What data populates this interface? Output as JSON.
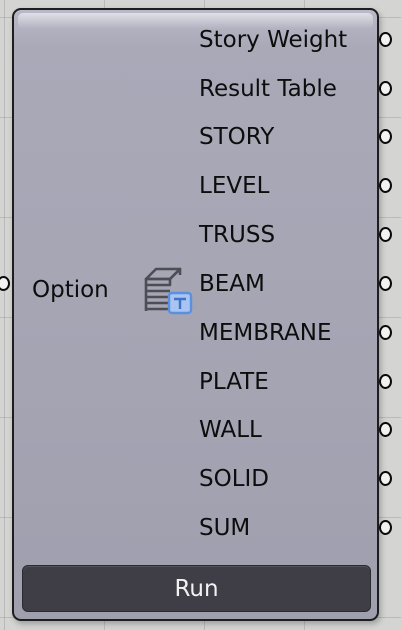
{
  "component": {
    "input_label": "Option",
    "outputs": [
      "Story Weight",
      "Result Table",
      "STORY",
      "LEVEL",
      "TRUSS",
      "BEAM",
      "MEMBRANE",
      "PLATE",
      "WALL",
      "SOLID",
      "SUM"
    ],
    "run_label": "Run",
    "icon": "stacked-floors-table-icon",
    "colors": {
      "body": "#a6a6b5",
      "border": "#1e1e1e",
      "run_button": "#3f3d45",
      "icon_accent": "#5b8fe0"
    }
  }
}
